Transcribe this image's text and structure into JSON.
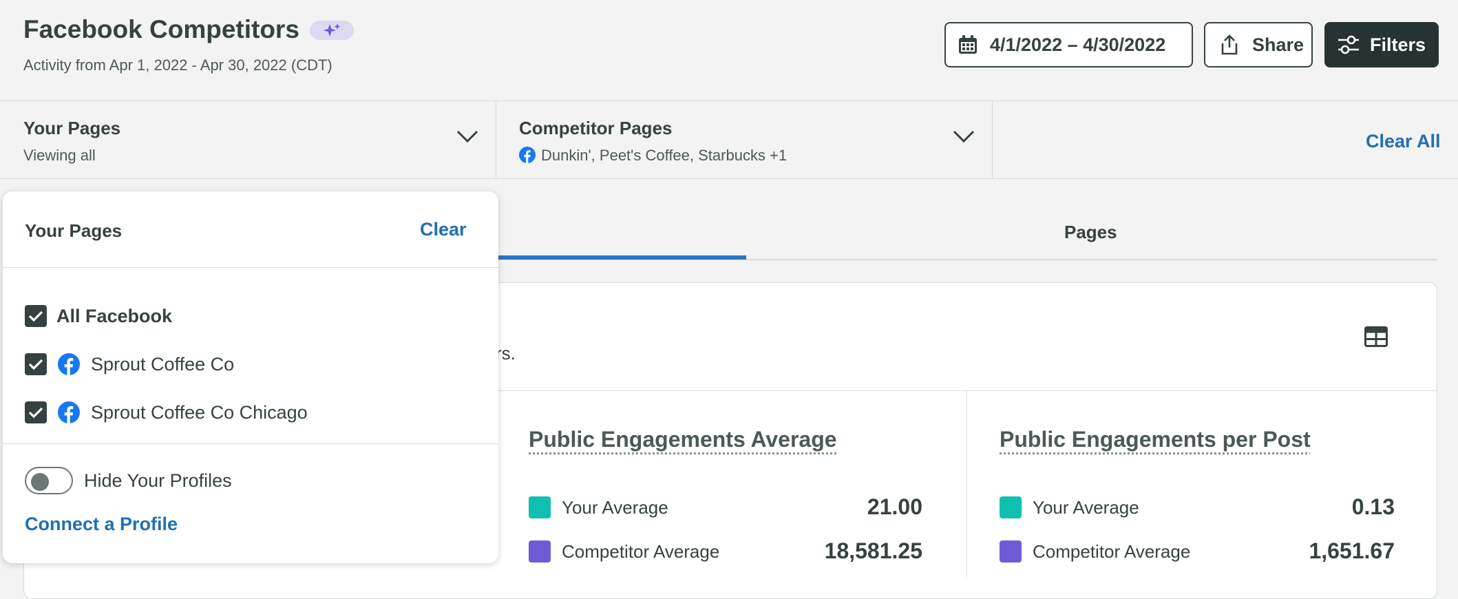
{
  "header": {
    "title": "Facebook Competitors",
    "subtitle": "Activity from Apr 1, 2022 - Apr 30, 2022 (CDT)",
    "date_range": "4/1/2022 – 4/30/2022",
    "share_label": "Share",
    "filters_label": "Filters",
    "icons": [
      "sparkles-icon",
      "calendar-icon",
      "share-icon",
      "sliders-icon"
    ]
  },
  "filter_bar": {
    "your_pages": {
      "title": "Your Pages",
      "subtitle": "Viewing all"
    },
    "competitor_pages": {
      "title": "Competitor Pages",
      "subtitle": "Dunkin', Peet's Coffee, Starbucks +1"
    },
    "clear_all": "Clear All"
  },
  "tabs": {
    "pages_label": "Pages"
  },
  "card": {
    "partial_text": "rs.",
    "metrics": [
      {
        "title": "Public Engagements Average",
        "rows": [
          {
            "label": "Your Average",
            "value": "21.00",
            "color": "#0fc0b0"
          },
          {
            "label": "Competitor Average",
            "value": "18,581.25",
            "color": "#6f5bd6"
          }
        ]
      },
      {
        "title": "Public Engagements per Post",
        "rows": [
          {
            "label": "Your Average",
            "value": "0.13",
            "color": "#0fc0b0"
          },
          {
            "label": "Competitor Average",
            "value": "1,651.67",
            "color": "#6f5bd6"
          }
        ]
      }
    ]
  },
  "dropdown": {
    "title": "Your Pages",
    "clear_label": "Clear",
    "options": [
      {
        "label": "All Facebook",
        "checked": true
      },
      {
        "label": "Sprout Coffee Co",
        "checked": true,
        "icon": "facebook-icon"
      },
      {
        "label": "Sprout Coffee Co Chicago",
        "checked": true,
        "icon": "facebook-icon"
      }
    ],
    "hide_profiles_label": "Hide Your Profiles",
    "connect_label": "Connect a Profile"
  }
}
